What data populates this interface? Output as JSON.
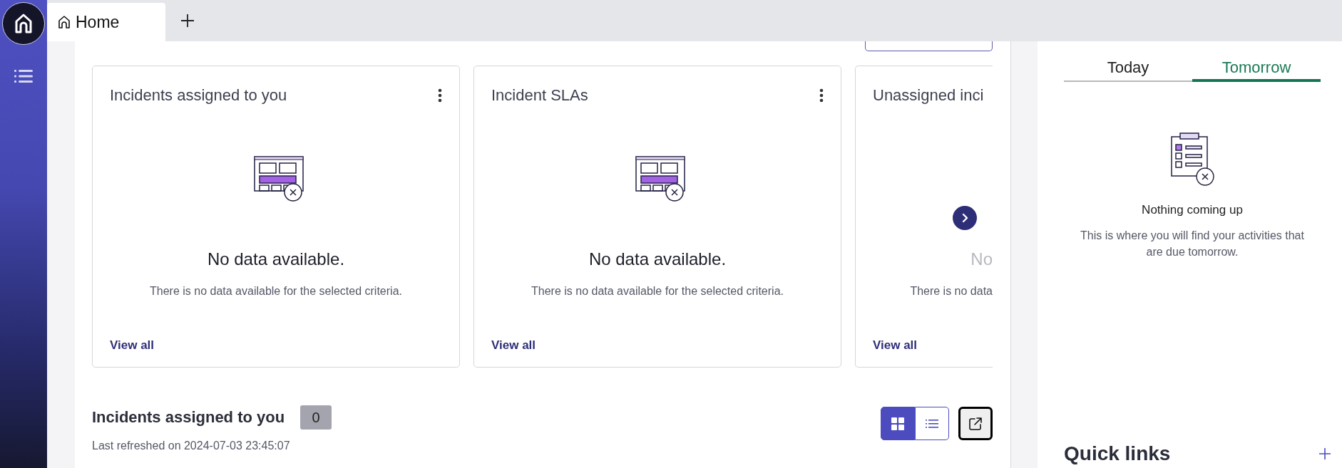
{
  "tabs": [
    {
      "label": "Home",
      "selected": true
    }
  ],
  "cards": [
    {
      "title": "Incidents assigned to you",
      "empty_title": "No data available.",
      "empty_text": "There is no data available for the selected criteria.",
      "link": "View all",
      "clipped": false
    },
    {
      "title": "Incident SLAs",
      "empty_title": "No data available.",
      "empty_text": "There is no data available for the selected criteria.",
      "link": "View all",
      "clipped": false
    },
    {
      "title": "Unassigned inci",
      "empty_title": "No",
      "empty_text": "There is no data",
      "link": "View all",
      "clipped": true
    }
  ],
  "incidents_section": {
    "title": "Incidents assigned to you",
    "count": "0",
    "last_refreshed": "Last refreshed on 2024-07-03 23:45:07"
  },
  "view_modes": [
    {
      "kind": "grid",
      "selected": true
    },
    {
      "kind": "list",
      "selected": false
    }
  ],
  "activities": {
    "tabs": [
      {
        "label": "Today",
        "selected": false
      },
      {
        "label": "Tomorrow",
        "selected": true
      }
    ],
    "empty_title": "Nothing coming up",
    "empty_text": "This is where you will find your activities that are due tomorrow."
  },
  "quick_links": {
    "title": "Quick links"
  }
}
